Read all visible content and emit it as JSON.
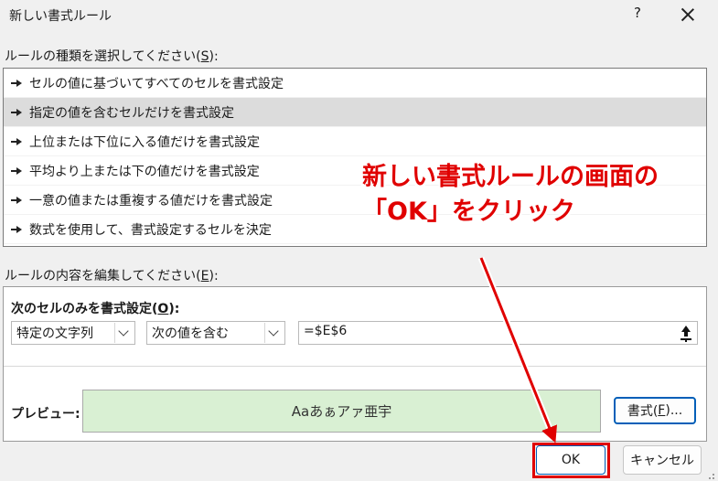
{
  "window": {
    "title": "新しい書式ルール",
    "help_label": "?"
  },
  "rule_type": {
    "label_prefix": "ルールの種類を選択してください(",
    "label_mnemonic": "S",
    "label_suffix": "):",
    "items": [
      {
        "label": "セルの値に基づいてすべてのセルを書式設定",
        "selected": false
      },
      {
        "label": "指定の値を含むセルだけを書式設定",
        "selected": true
      },
      {
        "label": "上位または下位に入る値だけを書式設定",
        "selected": false
      },
      {
        "label": "平均より上または下の値だけを書式設定",
        "selected": false
      },
      {
        "label": "一意の値または重複する値だけを書式設定",
        "selected": false
      },
      {
        "label": "数式を使用して、書式設定するセルを決定",
        "selected": false
      }
    ]
  },
  "rule_edit": {
    "label_prefix": "ルールの内容を編集してください(",
    "label_mnemonic": "E",
    "label_suffix": "):",
    "heading_prefix": "次のセルのみを書式設定(",
    "heading_mnemonic": "O",
    "heading_suffix": "):",
    "condition_type": "特定の文字列",
    "operator": "次の値を含む",
    "value": "=$E$6",
    "preview_label": "プレビュー:",
    "preview_text": "Aaあぁアァ亜宇",
    "preview_bg": "#d9f0d3",
    "format_button_prefix": "書式(",
    "format_button_mnemonic": "F",
    "format_button_suffix": ")..."
  },
  "buttons": {
    "ok": "OK",
    "cancel": "キャンセル"
  },
  "annotation": {
    "line1": "新しい書式ルールの画面の",
    "line2": "「OK」をクリック",
    "color": "#e00000"
  }
}
